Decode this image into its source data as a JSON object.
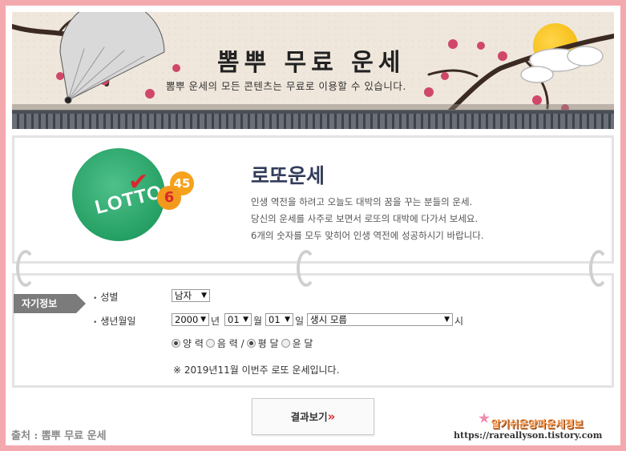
{
  "banner": {
    "title": "뽐뿌 무료 운세",
    "subtitle": "뽐뿌 운세의 모든 콘텐츠는 무료로 이용할 수 있습니다."
  },
  "lotto": {
    "logo_text": "LOTTO",
    "ball_6": "6",
    "ball_45": "45",
    "title": "로또운세",
    "desc": [
      "인생 역전을 하려고 오늘도 대박의 꿈을 꾸는 분들의 운세.",
      "당신의 운세를 사주로 보면서 로또의 대박에 다가서 보세요.",
      "6개의 숫자를 모두 맞히어 인생 역전에 성공하시기 바랍니다."
    ]
  },
  "form": {
    "tag": "자기정보",
    "gender_label": "성별",
    "gender_value": "남자",
    "birth_label": "생년월일",
    "year_value": "2000",
    "year_unit": "년",
    "month_value": "01",
    "month_unit": "월",
    "day_value": "01",
    "day_unit": "일",
    "hour_value": "생시 모름",
    "hour_unit": "시",
    "radio_solar": "양 력",
    "radio_lunar": "음 력 /",
    "radio_normal": "평 달",
    "radio_leap": "윤 달",
    "note": "※ 2019년11월 이번주 로또 운세입니다."
  },
  "result_button": {
    "label": "결과보기",
    "chevron": "»"
  },
  "footer": {
    "source": "출처 : 뽐뿌 무료 운세",
    "blog_name": "알기쉬운양파운세정보",
    "blog_url": "https://rareallyson.tistory.com"
  },
  "colors": {
    "frame": "#f4a9ae",
    "accent_red": "#d9272e",
    "lotto_green": "#25a064"
  }
}
